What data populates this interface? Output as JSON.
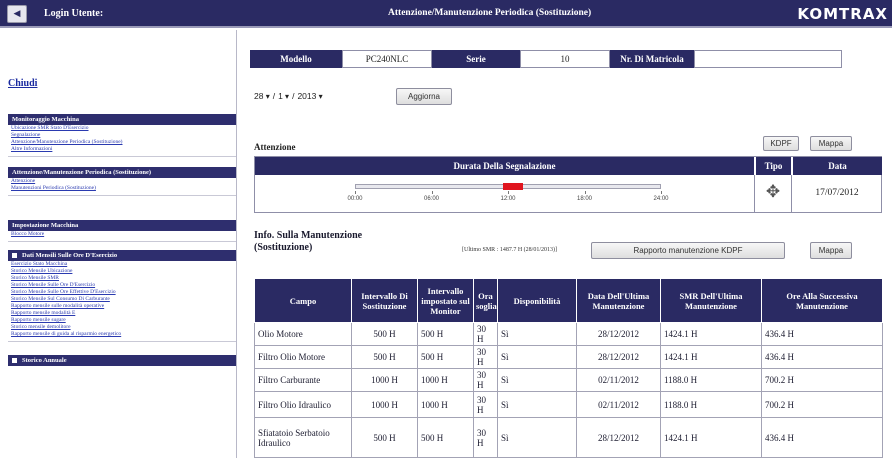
{
  "header": {
    "back_icon": "back-arrow-icon",
    "login_label": "Login Utente:",
    "title": "Attenzione/Manutenzione Periodica (Sostituzione)",
    "brand": "KOMTRAX",
    "bar_color": "#2a2a63"
  },
  "sidebar": {
    "close_link": "Chiudi",
    "sections": [
      {
        "heading": "Monitoraggio Macchina",
        "items": [
          "Ubicazione SMR Stato D'Esercizio",
          "Segnalazione",
          "Attenzione/Manutenzione Periodica (Sostituzione)",
          "Altre Informazioni"
        ]
      },
      {
        "heading": "Attenzione/Manutenzione Periodica (Sostituzione)",
        "items": [
          "Attenzione",
          "Manutenzioni Periodica (Sostituzione)"
        ]
      },
      {
        "heading": "Impostazione Macchina",
        "items": [
          "Blocco Motore"
        ]
      },
      {
        "heading": "Dati Mensili Sulle Ore D'Esercizio",
        "items": [
          "Esercizio Stato Macchina",
          "Storico Mensile Ubicazione",
          "Storico Mensile SMR",
          "Storico Mensile Sulle Ore D'Esercizio",
          "Storico Mensile Sulle Ore Effettive D'Esercizio",
          "Storico Mensile Sul Consumo Di Carburante",
          "Rapporto mensile sulle modalità operative",
          "Rapporto mensile modalità E",
          "Rapporto mensile sugare",
          "Storico mensile demolitore",
          "Rapporto mensile di guida al risparmio energetico"
        ]
      },
      {
        "heading": "Storico Annuale",
        "items": []
      }
    ]
  },
  "machine": {
    "model_label": "Modello",
    "model_value": "PC240NLC",
    "series_label": "Serie",
    "series_value": "10",
    "serial_label": "Nr. Di Matricola",
    "serial_value": ""
  },
  "date_filter": {
    "day": "28",
    "month": "1",
    "year": "2013",
    "update_button": "Aggiorna"
  },
  "attention": {
    "title": "Attenzione",
    "kdpf_button": "KDPF",
    "map_button": "Mappa",
    "col_duration": "Durata Della Segnalazione",
    "col_type": "Tipo",
    "col_date": "Data",
    "time_ticks": [
      "00:00",
      "06:00",
      "12:00",
      "18:00",
      "24:00"
    ],
    "signal_start_hour": 11.5,
    "signal_end_hour": 13.1,
    "signal_color": "#e0141e",
    "type_icon": "engine-warning-icon",
    "date": "17/07/2012"
  },
  "maintenance": {
    "title": "Info. Sulla Manutenzione (Sostituzione)",
    "last_smr": "[Ultimo SMR : 1487.7 H (28/01/2013)]",
    "report_button": "Rapporto manutenzione KDPF",
    "map_button": "Mappa",
    "columns": [
      "Campo",
      "Intervallo Di Sostituzione",
      "Intervallo impostato sul Monitor",
      "Ora soglia",
      "Disponibilità",
      "Data Dell'Ultima Manutenzione",
      "SMR Dell'Ultima Manutenzione",
      "Ore Alla Successiva Manutenzione"
    ],
    "rows": [
      [
        "Olio Motore",
        "500 H",
        "500 H",
        "30 H",
        "Sì",
        "28/12/2012",
        "1424.1 H",
        "436.4 H"
      ],
      [
        "Filtro Olio Motore",
        "500 H",
        "500 H",
        "30 H",
        "Sì",
        "28/12/2012",
        "1424.1 H",
        "436.4 H"
      ],
      [
        "Filtro Carburante",
        "1000 H",
        "1000 H",
        "30 H",
        "Sì",
        "02/11/2012",
        "1188.0 H",
        "700.2 H"
      ],
      [
        "Filtro Olio Idraulico",
        "1000 H",
        "1000 H",
        "30 H",
        "Sì",
        "02/11/2012",
        "1188.0 H",
        "700.2 H"
      ],
      [
        "Sfiatatoio Serbatoio Idraulico",
        "500 H",
        "500 H",
        "30 H",
        "Sì",
        "28/12/2012",
        "1424.1 H",
        "436.4 H"
      ]
    ]
  }
}
